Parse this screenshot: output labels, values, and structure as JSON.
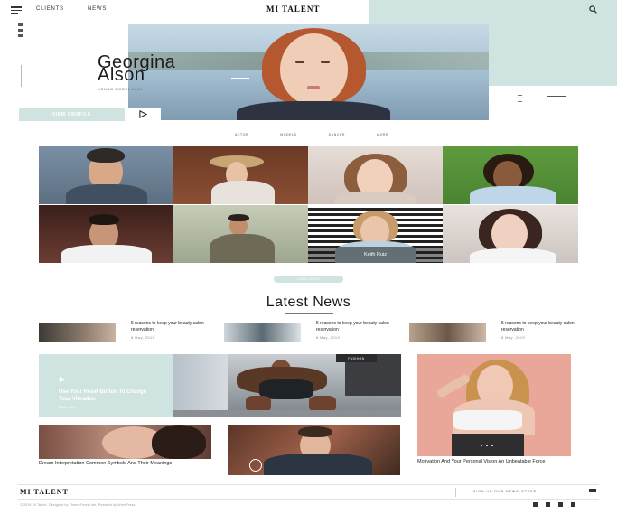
{
  "header": {
    "nav": [
      "CLIENTS",
      "NEWS"
    ],
    "logo": "MI TALENT"
  },
  "hero": {
    "first_name": "Georgina",
    "last_name": "Alson",
    "subtitle": "YOUNG MODEL 2019",
    "cta_label": "VIEW PROFILE"
  },
  "filters": [
    "ACTOR",
    "MODELS",
    "DANCER",
    "MORE"
  ],
  "grid": {
    "caption_label": "Keith Ruiz",
    "load_more_label": "LOAD MORE"
  },
  "news": {
    "title": "Latest News",
    "items": [
      {
        "text": "5 reasons to keep your beauty salon reservation",
        "date": "8 May, 2019"
      },
      {
        "text": "5 reasons to keep your beauty salon reservation",
        "date": "8 May, 2019"
      },
      {
        "text": "5 reasons to keep your beauty salon reservation",
        "date": "8 May, 2019"
      }
    ],
    "feature_text": "Use Your Reset Button To Change Your Vibration",
    "feature_date": "8 May, 2019",
    "feature_badge": "FASHION",
    "bottom_captions": [
      "Dream Interpretation Common Symbols And Their Meanings",
      "Motivation And Your Personal Vision An Unbeatable Force"
    ]
  },
  "footer": {
    "logo": "MI TALENT",
    "newsletter": "SIGN UP OUR NEWSLETTER",
    "copyright": "© 2019 MI Talent. Designed by ThemeForest.net. Powered by WordPress."
  },
  "colors": {
    "accent": "#cfe3e1",
    "peach": "#e9a79a",
    "text": "#222222"
  }
}
